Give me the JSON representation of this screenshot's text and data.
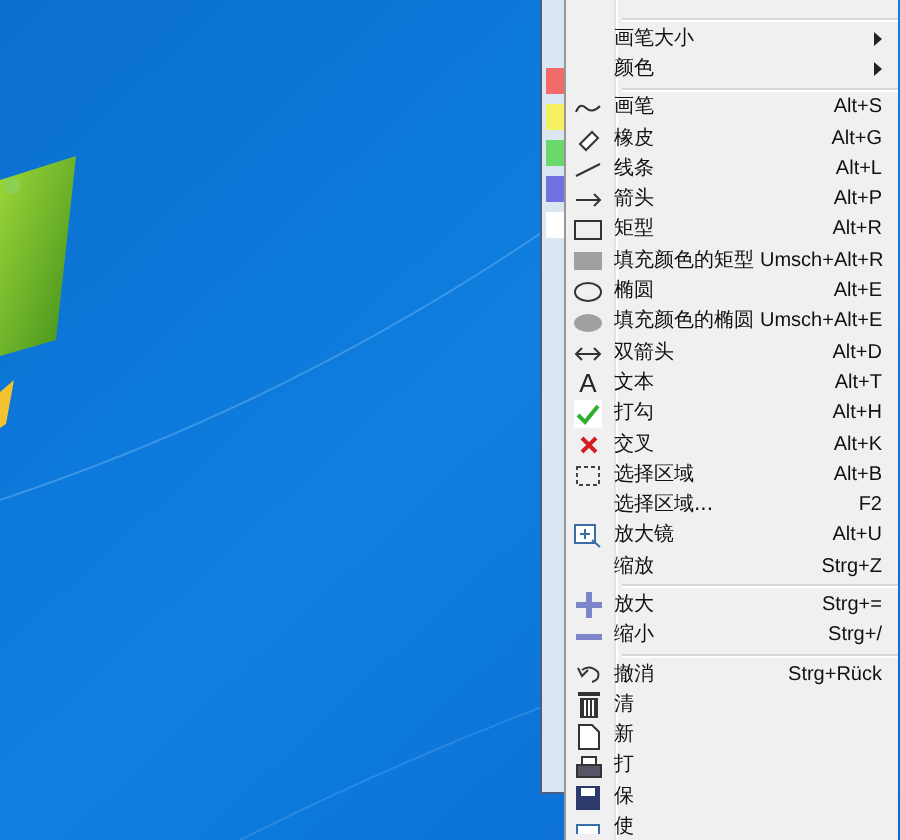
{
  "menu": {
    "groups": [
      [
        {
          "label": "画笔大小",
          "submenu": true
        },
        {
          "label": "颜色",
          "submenu": true
        }
      ],
      [
        {
          "label": "画笔",
          "shortcut": "Alt+S"
        },
        {
          "label": "橡皮",
          "shortcut": "Alt+G"
        },
        {
          "label": "线条",
          "shortcut": "Alt+L"
        },
        {
          "label": "箭头",
          "shortcut": "Alt+P"
        },
        {
          "label": "矩型",
          "shortcut": "Alt+R"
        },
        {
          "label": "填充颜色的矩型",
          "shortcut": "Umsch+Alt+R"
        },
        {
          "label": "椭圆",
          "shortcut": "Alt+E"
        },
        {
          "label": "填充颜色的椭圆",
          "shortcut": "Umsch+Alt+E"
        },
        {
          "label": "双箭头",
          "shortcut": "Alt+D"
        },
        {
          "label": "文本",
          "shortcut": "Alt+T",
          "icon_text": "A"
        },
        {
          "label": "打勾",
          "shortcut": "Alt+H",
          "checked": true
        },
        {
          "label": "交叉",
          "shortcut": "Alt+K"
        },
        {
          "label": "选择区域",
          "shortcut": "Alt+B"
        },
        {
          "label": "选择区域...",
          "shortcut": "F2"
        },
        {
          "label": "放大镜",
          "shortcut": "Alt+U"
        },
        {
          "label": "缩放",
          "shortcut": "Strg+Z"
        }
      ],
      [
        {
          "label": "放大",
          "shortcut": "Strg+="
        },
        {
          "label": "缩小",
          "shortcut": "Strg+/"
        }
      ],
      [
        {
          "label": "撤消",
          "shortcut": "Strg+Rück"
        },
        {
          "label": "清"
        },
        {
          "label": "新"
        },
        {
          "label": "打"
        },
        {
          "label": "保"
        },
        {
          "label": "使"
        }
      ]
    ]
  }
}
